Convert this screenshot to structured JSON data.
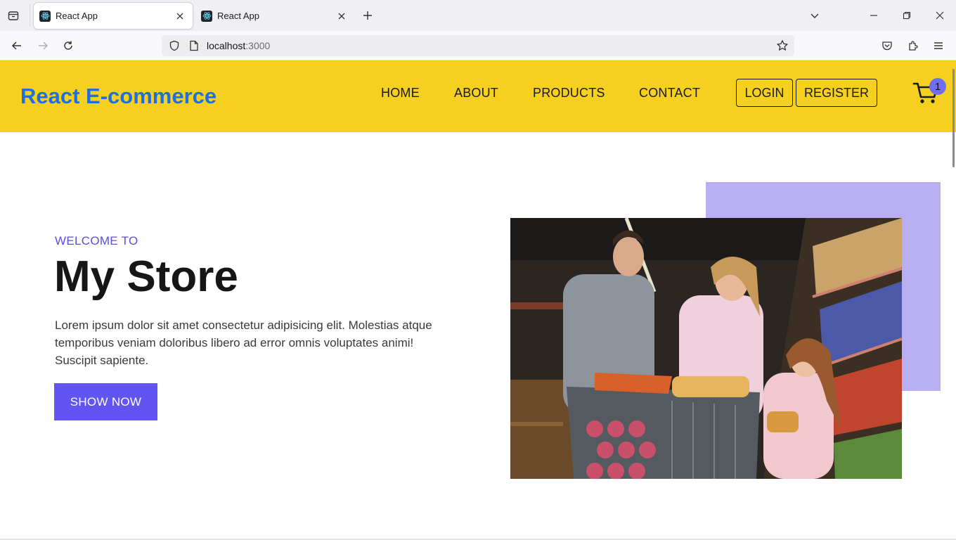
{
  "browser": {
    "tabs": [
      {
        "title": "React App",
        "active": true
      },
      {
        "title": "React App",
        "active": false
      }
    ],
    "url": {
      "host": "localhost",
      "port": ":3000"
    },
    "icons": [
      "tab-overview-icon",
      "react-favicon-icon",
      "close-icon",
      "plus-icon",
      "chevron-down-icon",
      "minimize-icon",
      "restore-icon",
      "window-close-icon",
      "back-arrow-icon",
      "forward-arrow-icon",
      "reload-icon",
      "shield-icon",
      "page-icon",
      "star-icon",
      "pocket-icon",
      "extensions-icon",
      "menu-icon"
    ]
  },
  "header": {
    "brand": "React E-commerce",
    "menu": [
      "HOME",
      "ABOUT",
      "PRODUCTS",
      "CONTACT"
    ],
    "login_label": "LOGIN",
    "register_label": "REGISTER",
    "cart_count": "1",
    "colors": {
      "background": "#f6d020",
      "brand": "#1f6fe0",
      "badge": "#6f6ef0"
    }
  },
  "hero": {
    "eyebrow": "WELCOME TO",
    "title": "My Store",
    "description": "Lorem ipsum dolor sit amet consectetur adipisicing elit. Molestias atque temporibus veniam doloribus libero ad error omnis voluptates animi! Suscipit sapiente.",
    "cta_label": "SHOW NOW",
    "image_subject": "family shopping with cart in supermarket",
    "colors": {
      "accent": "#6254f0",
      "accent_box": "#b8aff2"
    }
  }
}
